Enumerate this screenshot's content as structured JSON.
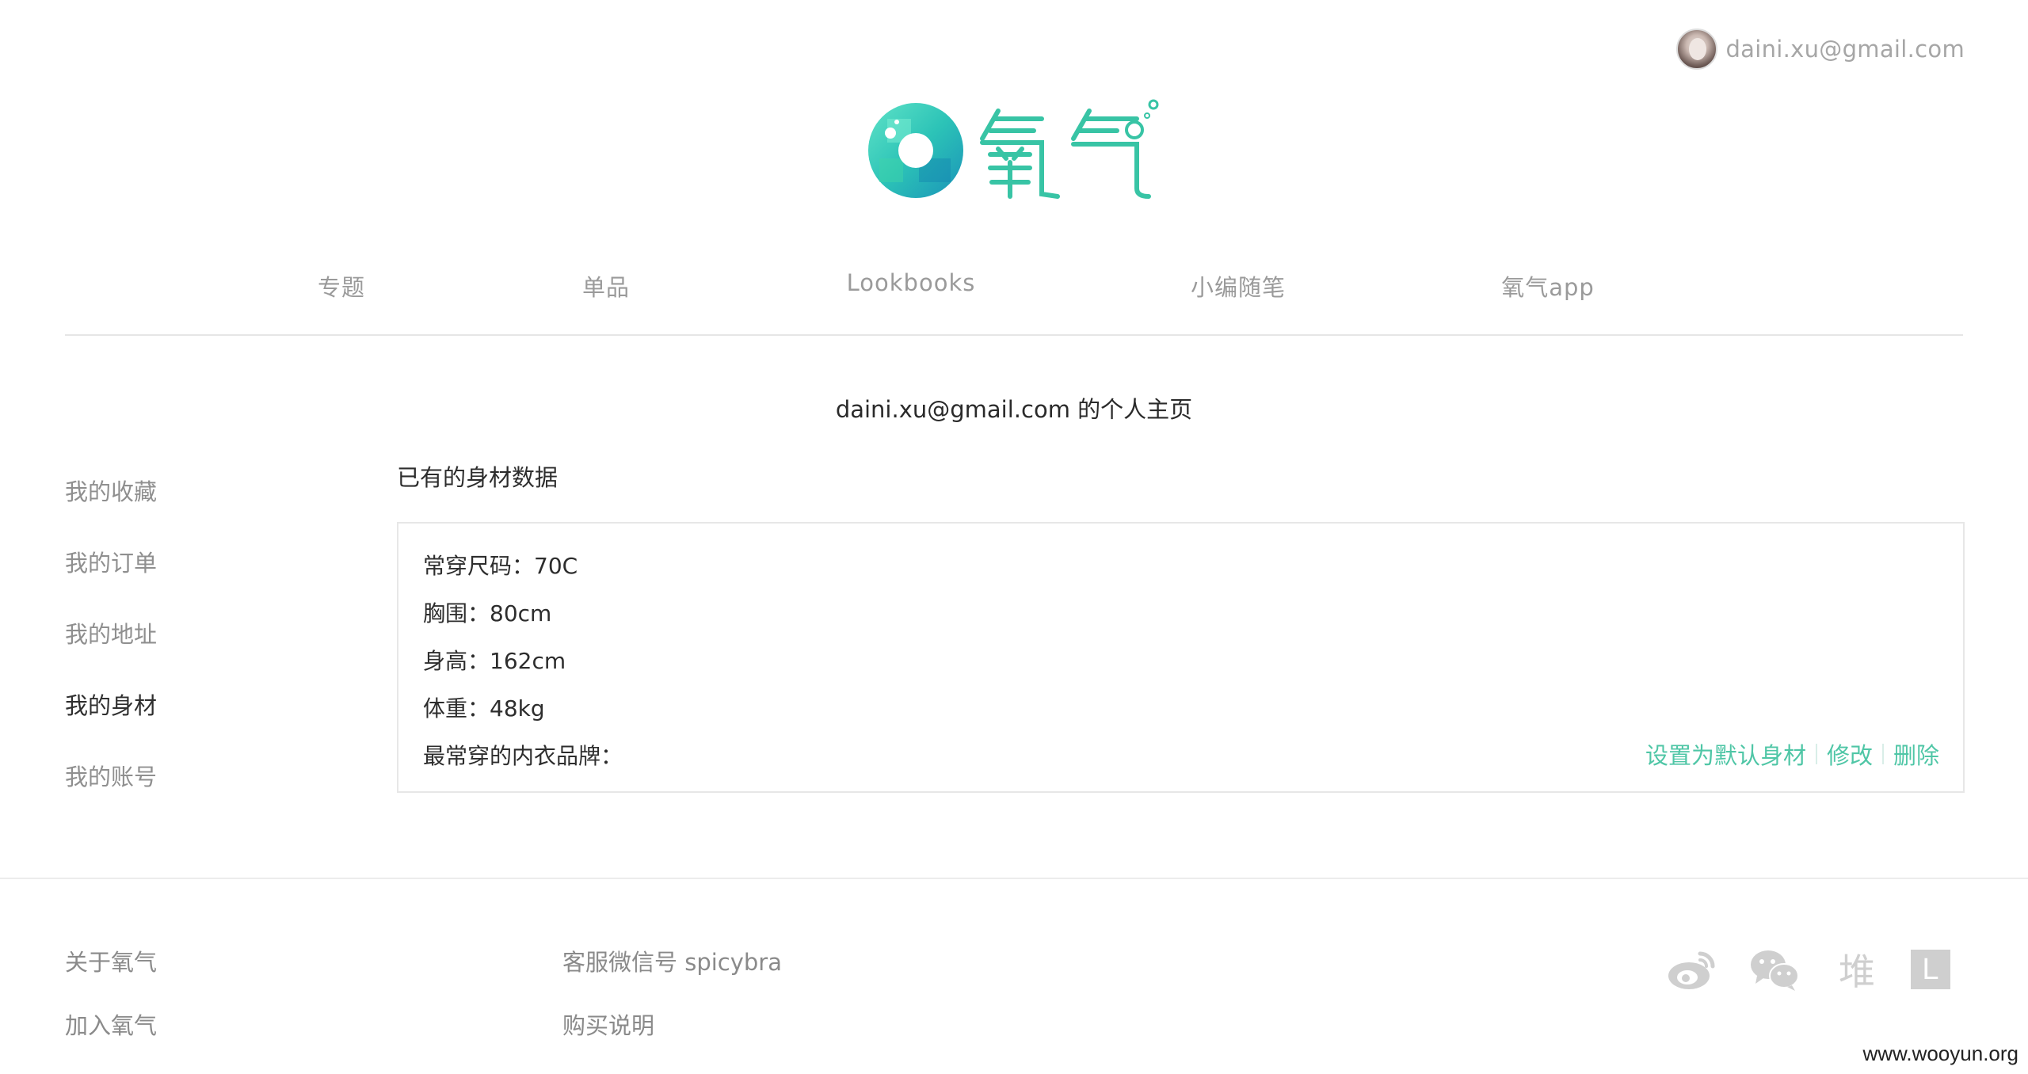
{
  "header": {
    "user_email": "daini.xu@gmail.com",
    "logo_text": "氧气"
  },
  "nav": {
    "items": [
      {
        "label": "专题"
      },
      {
        "label": "单品"
      },
      {
        "label": "Lookbooks"
      },
      {
        "label": "小编随笔"
      },
      {
        "label": "氧气app"
      }
    ]
  },
  "page": {
    "heading": "daini.xu@gmail.com 的个人主页"
  },
  "sidebar": {
    "items": [
      {
        "label": "我的收藏",
        "active": false
      },
      {
        "label": "我的订单",
        "active": false
      },
      {
        "label": "我的地址",
        "active": false
      },
      {
        "label": "我的身材",
        "active": true
      },
      {
        "label": "我的账号",
        "active": false
      }
    ]
  },
  "main": {
    "section_title": "已有的身材数据",
    "body": {
      "size": "常穿尺码：70C",
      "bust": "胸围：80cm",
      "height": "身高：162cm",
      "weight": "体重：48kg",
      "brand": "最常穿的内衣品牌："
    },
    "actions": {
      "set_default": "设置为默认身材",
      "edit": "修改",
      "delete": "删除"
    }
  },
  "footer": {
    "about": "关于氧气",
    "join": "加入氧气",
    "service_wechat": "客服微信号 spicybra",
    "purchase_info": "购买说明",
    "social": [
      {
        "icon": "weibo-icon"
      },
      {
        "icon": "wechat-icon"
      },
      {
        "icon": "duitang-icon",
        "text": "堆"
      },
      {
        "icon": "lofter-icon",
        "text": "L"
      }
    ]
  },
  "watermark": "www.wooyun.org",
  "colors": {
    "accent": "#4fc6a6",
    "nav_text": "#9a9a9a",
    "icon_gray": "#cfcfcf"
  }
}
